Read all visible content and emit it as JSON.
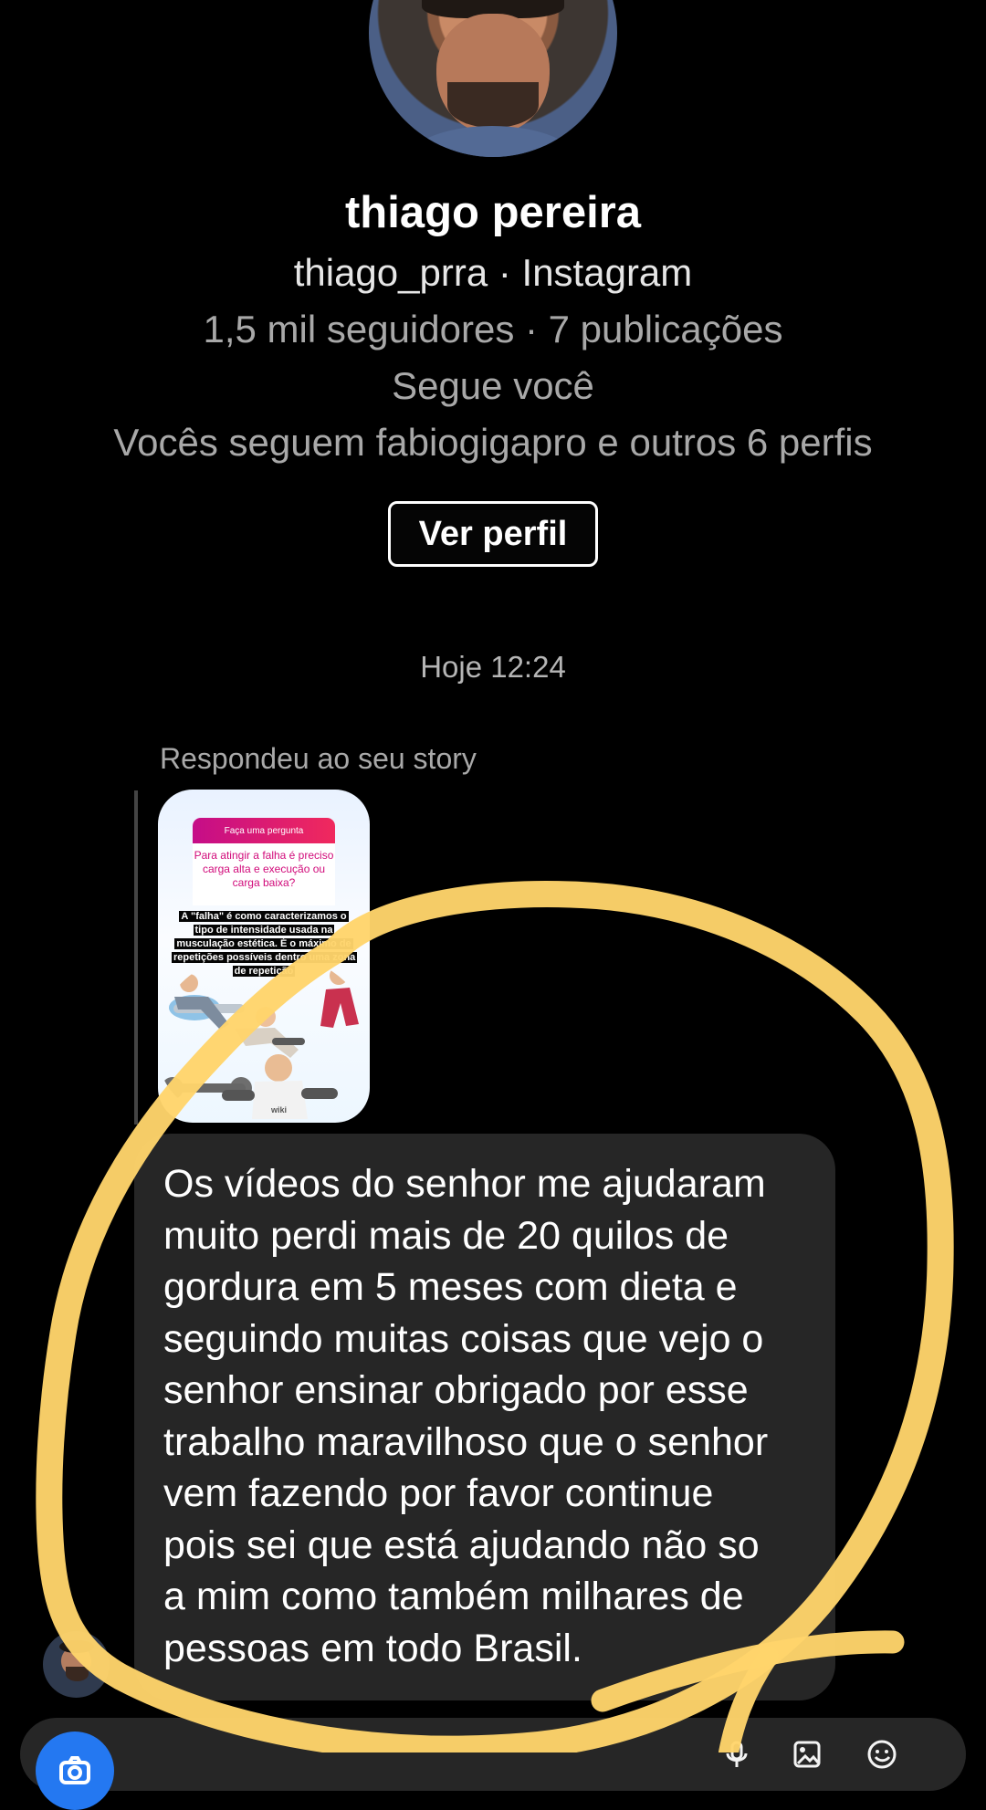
{
  "profile": {
    "name": "thiago pereira",
    "username_source": "thiago_prra · Instagram",
    "stats": "1,5 mil seguidores · 7 publicações",
    "follow_status": "Segue você",
    "mutuals": "Vocês seguem fabiogigapro e outros 6 perfis",
    "view_profile": "Ver perfil"
  },
  "conversation": {
    "timestamp": "Hoje 12:24",
    "story_reply_label": "Respondeu ao seu story",
    "story": {
      "question_banner": "Faça uma pergunta",
      "question": "Para atingir a falha é preciso carga alta e execução ou carga baixa?",
      "answer": "A \"falha\" é como caracterizamos o tipo de intensidade usada na musculação estética. É o máximo de repetições possíveis dentro uma zona de repetição",
      "watermark": "wiki"
    },
    "message": "Os vídeos do senhor me ajudaram\nmuito perdi mais de 20 quilos de\ngordura em 5 meses com dieta e\nseguindo muitas coisas que vejo o\nsenhor ensinar obrigado por esse\ntrabalho maravilhoso que o senhor\nvem fazendo por favor continue\npois sei que está ajudando não so\na mim como também milhares de\npessoas em todo Brasil."
  },
  "icons": {
    "camera": "camera-icon",
    "microphone": "microphone-icon",
    "gallery": "gallery-icon",
    "sticker": "sticker-icon"
  },
  "colors": {
    "background": "#000000",
    "message_bubble": "#262626",
    "annotation": "#ffd46b",
    "camera": "#2478f1"
  }
}
